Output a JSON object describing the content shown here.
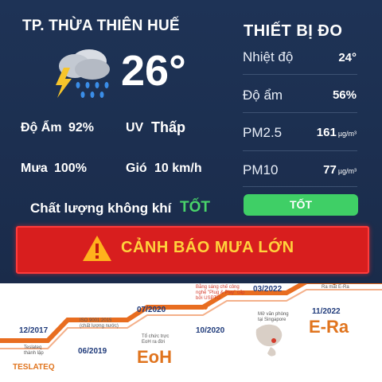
{
  "location": "TP. THỪA THIÊN HUẾ",
  "weather": {
    "icon": "thunderstorm-rain-icon",
    "temperature": "26°",
    "humidity_label": "Độ Ẩm",
    "humidity_value": "92%",
    "uv_label": "UV",
    "uv_value": "Thấp",
    "rain_label": "Mưa",
    "rain_value": "100%",
    "wind_label": "Gió",
    "wind_value": "10 km/h"
  },
  "air_quality": {
    "label": "Chất lượng không khí",
    "value": "TỐT"
  },
  "device": {
    "title": "THIẾT BỊ ĐO",
    "measurements": [
      {
        "label": "Nhiệt độ",
        "value": "24°",
        "unit": ""
      },
      {
        "label": "Độ ẩm",
        "value": "56%",
        "unit": ""
      },
      {
        "label": "PM2.5",
        "value": "161",
        "unit": "µg/m³"
      },
      {
        "label": "PM10",
        "value": "77",
        "unit": "µg/m³"
      }
    ],
    "status_button": "TỐT"
  },
  "alert": {
    "text": "CẢNH BÁO MƯA LỚN",
    "icon": "warning-icon"
  },
  "timeline": {
    "milestones": [
      {
        "date": "12/2017",
        "text": "Teslateq thành lập"
      },
      {
        "date": "06/2019",
        "text": "ISO 9001:2015 (chất lượng nước)"
      },
      {
        "date": "07/2020",
        "text": "Tổ chức trực EoH ra đời"
      },
      {
        "date": "10/2020",
        "text": "Bằng sáng chế công nghệ \"Plug & Play\" cấp bởi USPTO"
      },
      {
        "date": "03/2022",
        "text": "Mở văn phòng tại Singapore"
      },
      {
        "date": "11/2022",
        "text": "Ra mắt E-Ra"
      }
    ],
    "logos": {
      "teslateq": "TESLATEQ",
      "eoh": "EoH",
      "era": "E-Ra"
    }
  },
  "colors": {
    "background": "#1e3356",
    "good": "#3fcf66",
    "alert": "#d81e1e",
    "alert_text": "#ffd23c",
    "accent": "#e0741e"
  }
}
